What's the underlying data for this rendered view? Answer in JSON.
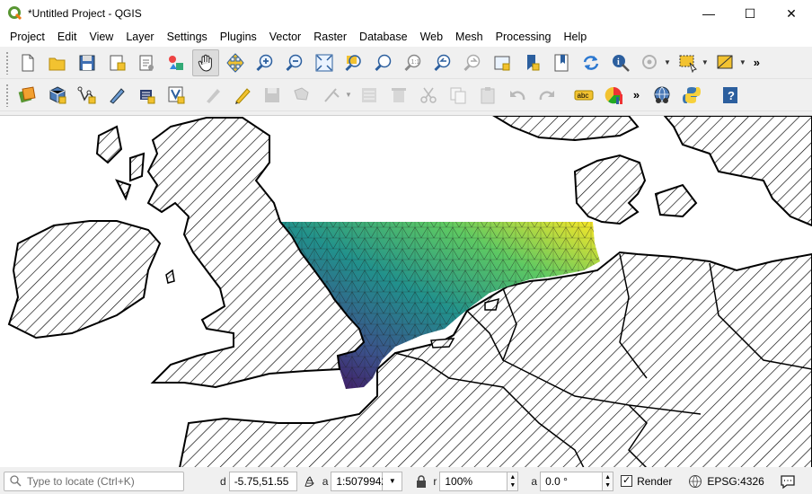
{
  "window": {
    "title": "*Untitled Project - QGIS",
    "minimize_glyph": "—",
    "maximize_glyph": "☐",
    "close_glyph": "✕"
  },
  "menu": [
    "Project",
    "Edit",
    "View",
    "Layer",
    "Settings",
    "Plugins",
    "Vector",
    "Raster",
    "Database",
    "Web",
    "Mesh",
    "Processing",
    "Help"
  ],
  "toolbar1": {
    "tools": [
      "new-project-icon",
      "open-project-icon",
      "save-project-icon",
      "new-print-layout-icon",
      "layout-manager-icon",
      "style-manager-icon",
      "pan-icon",
      "pan-to-selection-icon",
      "zoom-in-icon",
      "zoom-out-icon",
      "zoom-full-icon",
      "zoom-to-selection-icon",
      "zoom-to-layer-icon",
      "zoom-native-icon",
      "zoom-last-icon",
      "zoom-next-icon",
      "new-map-view-icon",
      "new-bookmark-icon",
      "show-bookmarks-icon",
      "refresh-icon",
      "identify-icon",
      "select-feature-icon",
      "select-rectangle-icon",
      "deselect-icon"
    ],
    "more_glyph": "»"
  },
  "toolbar2": {
    "tools": [
      "data-source-manager-icon",
      "new-geopackage-icon",
      "new-shapefile-icon",
      "digitize-icon",
      "new-temp-layer-icon",
      "virtual-layer-icon",
      "current-edits-icon",
      "toggle-editing-icon",
      "save-edits-icon",
      "add-feature-icon",
      "vertex-tool-icon",
      "modify-attributes-icon",
      "delete-selected-icon",
      "cut-features-icon",
      "copy-features-icon",
      "paste-features-icon",
      "undo-icon",
      "redo-icon",
      "label-icon",
      "diagram-icon",
      "metasearch-icon",
      "python-console-icon",
      "help-icon"
    ],
    "label_text": "abc",
    "more_glyph": "»"
  },
  "status": {
    "locate_placeholder": "Type to locate (Ctrl+K)",
    "coordinate_label": "d",
    "coordinate": "-5.75,51.55",
    "scale_label": "a",
    "scale": "1:5079942",
    "magnifier_label": "r",
    "magnifier": "100%",
    "rotation_label": "a",
    "rotation": "0.0 °",
    "render_label": "Render",
    "render_checked": true,
    "crs": "EPSG:4326"
  },
  "colors": {
    "mesh_low": "#440154",
    "mesh_mid": "#21918c",
    "mesh_high": "#fde725",
    "land_fill": "#ffffff",
    "land_hatch": "#000000"
  }
}
